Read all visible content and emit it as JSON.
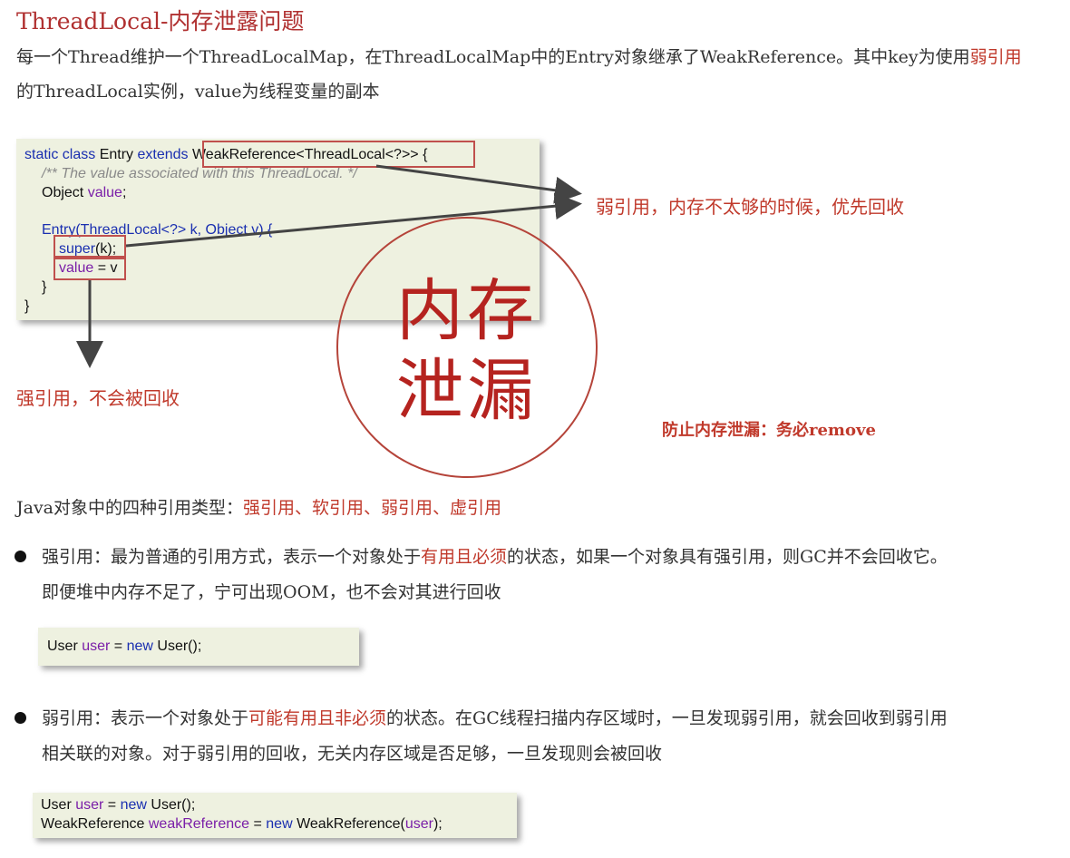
{
  "title": "ThreadLocal-内存泄露问题",
  "intro": {
    "line1_prefix": "每一个Thread维护一个ThreadLocalMap，在ThreadLocalMap中的Entry对象继承了WeakReference。其中key为使用",
    "line1_highlight": "弱引用",
    "line2": "的ThreadLocal实例，value为线程变量的副本"
  },
  "entry_code": {
    "line1": {
      "kw": "static class",
      "name": " Entry ",
      "kw2": "extends",
      "rest": " WeakReference<ThreadLocal<?>> {"
    },
    "comment": "/** The value associated with this ThreadLocal. */",
    "field": {
      "type": "Object ",
      "name": "value",
      "end": ";"
    },
    "ctor": "Entry(ThreadLocal<?> k, Object v) {",
    "super_call": {
      "kw": "super",
      "rest": "(k);"
    },
    "assign": {
      "name": "value",
      "rest": " = v"
    },
    "close_inner": "}",
    "close_outer": "}"
  },
  "annotations": {
    "weak_ref": "弱引用，内存不太够的时候，优先回收",
    "strong_ref": "强引用，不会被回收"
  },
  "stamp": {
    "line1": "内存",
    "line2": "泄漏"
  },
  "prevent": "防止内存泄漏：务必remove",
  "ref_types": {
    "prefix": "Java对象中的四种引用类型：",
    "list": "强引用、软引用、弱引用、虚引用"
  },
  "strong": {
    "line1_prefix": "强引用：最为普通的引用方式，表示一个对象处于",
    "line1_highlight": "有用且必须",
    "line1_suffix": "的状态，如果一个对象具有强引用，则GC并不会回收它。",
    "line2": "即便堆中内存不足了，宁可出现OOM，也不会对其进行回收",
    "code": {
      "type": "User ",
      "var": "user",
      "eq": " = ",
      "kw": "new",
      "rest": " User();"
    }
  },
  "weak": {
    "line1_prefix": "弱引用：表示一个对象处于",
    "line1_highlight": "可能有用且非必须",
    "line1_suffix": "的状态。在GC线程扫描内存区域时，一旦发现弱引用，就会回收到弱引用",
    "line2": "相关联的对象。对于弱引用的回收，无关内存区域是否足够，一旦发现则会被回收",
    "code1": {
      "type": "User ",
      "var": "user",
      "eq": " = ",
      "kw": "new",
      "rest": " User();"
    },
    "code2": {
      "type": "WeakReference ",
      "var": "weakReference",
      "eq": " = ",
      "kw": "new",
      "rest": " WeakReference(",
      "arg": "user",
      "end": ");"
    }
  }
}
